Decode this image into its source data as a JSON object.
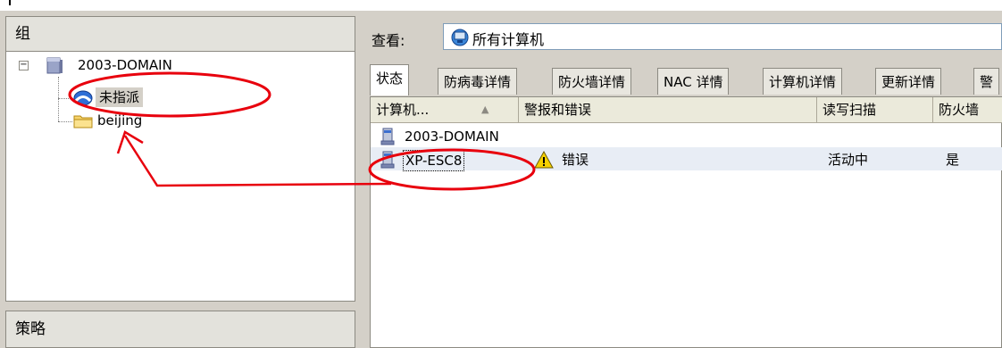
{
  "left": {
    "group_header": "组",
    "tree": {
      "root": "2003-DOMAIN",
      "children": [
        "未指派",
        "beijing"
      ]
    },
    "policy_header": "策略"
  },
  "right": {
    "view_label": "查看:",
    "view_value": "所有计算机",
    "tabs": [
      "状态",
      "防病毒详情",
      "防火墙详情",
      "NAC 详情",
      "计算机详情",
      "更新详情",
      "警"
    ],
    "columns": [
      "计算机...",
      "警报和错误",
      "读写扫描",
      "防火墙"
    ],
    "sort_indicator": "▲",
    "rows": [
      {
        "computer": "2003-DOMAIN",
        "alerts": "",
        "scan": "",
        "firewall": ""
      },
      {
        "computer": "XP-ESC8",
        "alerts": "错误",
        "scan": "活动中",
        "firewall": "是"
      }
    ]
  },
  "colors": {
    "annotation": "#e8000d",
    "panel_bg": "#d4d0c8",
    "header_bg": "#e3e2dc"
  }
}
